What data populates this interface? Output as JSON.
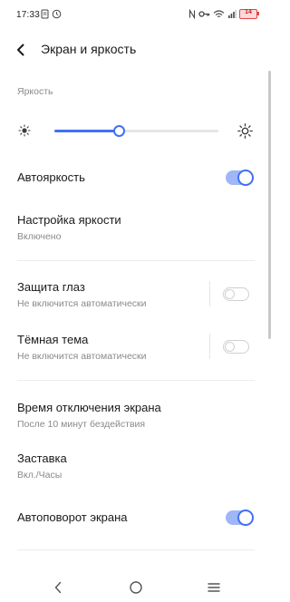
{
  "status_bar": {
    "time": "17:33",
    "battery_level": "14"
  },
  "app_bar": {
    "title": "Экран и яркость"
  },
  "brightness": {
    "section_label": "Яркость",
    "level": 0.39
  },
  "auto_brightness": {
    "label": "Автояркость",
    "enabled": true
  },
  "brightness_settings": {
    "title": "Настройка яркости",
    "subtitle": "Включено"
  },
  "eye_protection": {
    "title": "Защита глаз",
    "subtitle": "Не включится автоматически",
    "enabled": false
  },
  "dark_theme": {
    "title": "Тёмная тема",
    "subtitle": "Не включится автоматически",
    "enabled": false
  },
  "screen_timeout": {
    "title": "Время отключения экрана",
    "subtitle": "После 10 минут бездействия"
  },
  "screensaver": {
    "title": "Заставка",
    "subtitle": "Вкл./Часы"
  },
  "auto_rotate": {
    "title": "Автоповорот экрана",
    "enabled": true
  },
  "colors": {
    "accent": "#4170f5",
    "accent_light": "#9fb6f7",
    "secondary_text": "#8a8a8a"
  }
}
